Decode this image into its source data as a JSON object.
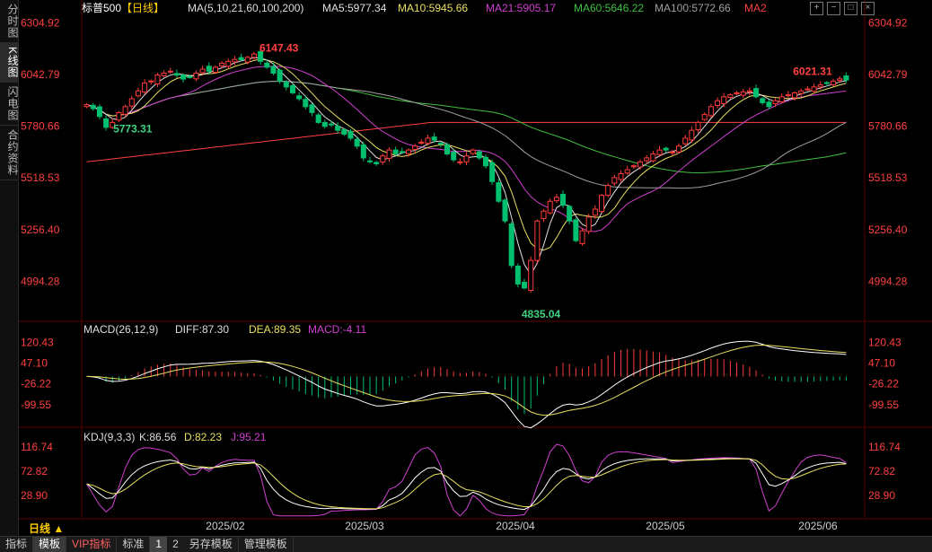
{
  "sidebar": {
    "tabs": [
      "分时图",
      "K线图",
      "闪电图",
      "合约资料"
    ],
    "active": 1
  },
  "header": {
    "instrument": "标普500",
    "period": "【日线】",
    "ma_label": "MA(5,10,21,60,100,200)",
    "ma_values": [
      {
        "text": "MA5:5977.34",
        "color": "#e0e0e0"
      },
      {
        "text": "MA10:5945.66",
        "color": "#e8e060"
      },
      {
        "text": "MA21:5905.17",
        "color": "#d040d0"
      },
      {
        "text": "MA60:5646.22",
        "color": "#40c040"
      },
      {
        "text": "MA100:5772.66",
        "color": "#a0a0a0"
      },
      {
        "text": "MA2",
        "color": "#ff4040"
      }
    ],
    "toolbar_icons": [
      "zoom-in-icon",
      "zoom-out-icon",
      "restore-icon",
      "close-icon"
    ],
    "toolbar_glyphs": [
      "+",
      "−",
      "□",
      "×"
    ]
  },
  "macd": {
    "label": "MACD(26,12,9)",
    "diff": "DIFF:87.30",
    "dea": "DEA:89.35",
    "macd": "MACD:-4.11"
  },
  "kdj": {
    "label": "KDJ(9,3,3)",
    "k": "K:86.56",
    "d": "D:82.23",
    "j": "J:95.21"
  },
  "colors": {
    "up": "#ff3b3b",
    "down": "#00c070",
    "axis_text": "#ff4040",
    "grid": "#3a0000"
  },
  "chart_data": [
    {
      "type": "candlestick",
      "title": "标普500【日线】",
      "y_ticks": [
        "6304.92",
        "6042.79",
        "5780.66",
        "5518.53",
        "5256.40",
        "4994.28"
      ],
      "ylim": [
        4800,
        6330
      ],
      "x_labels": [
        "2025/02",
        "2025/03",
        "2025/04",
        "2025/05",
        "2025/06"
      ],
      "annotations": [
        {
          "text": "6147.43",
          "kind": "high"
        },
        {
          "text": "5773.31",
          "kind": "low"
        },
        {
          "text": "4835.04",
          "kind": "low"
        },
        {
          "text": "6021.31",
          "kind": "high"
        }
      ],
      "ma200_range": [
        5600,
        5800
      ],
      "close_path": [
        5890,
        5870,
        5830,
        5775,
        5800,
        5850,
        5880,
        5920,
        5960,
        6000,
        6010,
        6040,
        6050,
        6060,
        6040,
        6020,
        6030,
        6050,
        6070,
        6060,
        6080,
        6100,
        6110,
        6120,
        6118,
        6130,
        6147,
        6110,
        6080,
        6050,
        6010,
        5980,
        5950,
        5920,
        5880,
        5850,
        5800,
        5780,
        5790,
        5760,
        5740,
        5720,
        5680,
        5620,
        5600,
        5590,
        5630,
        5660,
        5640,
        5650,
        5660,
        5680,
        5700,
        5720,
        5710,
        5690,
        5640,
        5610,
        5600,
        5630,
        5660,
        5620,
        5580,
        5500,
        5400,
        5300,
        5074,
        4980,
        4960,
        5100,
        5300,
        5350,
        5400,
        5420,
        5380,
        5300,
        5200,
        5250,
        5320,
        5360,
        5430,
        5480,
        5520,
        5540,
        5560,
        5580,
        5600,
        5620,
        5640,
        5660,
        5660,
        5650,
        5680,
        5720,
        5760,
        5800,
        5840,
        5880,
        5910,
        5930,
        5940,
        5950,
        5955,
        5960,
        5930,
        5900,
        5880,
        5910,
        5930,
        5940,
        5950,
        5960,
        5970,
        5980,
        5990,
        6000,
        6010,
        6021,
        6015
      ]
    },
    {
      "type": "bar+line",
      "title": "MACD(26,12,9)",
      "y_ticks": [
        "120.43",
        "47.10",
        "-26.22",
        "-99.55"
      ],
      "ylim": [
        -160,
        150
      ]
    },
    {
      "type": "line",
      "title": "KDJ(9,3,3)",
      "y_ticks": [
        "116.74",
        "72.82",
        "28.90"
      ],
      "ylim": [
        -10,
        130
      ]
    }
  ],
  "bottom": {
    "period_label": "日线 ▲",
    "tabs": [
      {
        "label": "指标",
        "vip": false,
        "active": false
      },
      {
        "label": "模板",
        "vip": false,
        "active": true
      },
      {
        "label": "VIP指标",
        "vip": true,
        "active": false
      },
      {
        "label": "标准",
        "vip": false,
        "active": false
      }
    ],
    "pages": [
      "1",
      "2"
    ],
    "tabs2": [
      "另存模板",
      "管理模板"
    ]
  }
}
